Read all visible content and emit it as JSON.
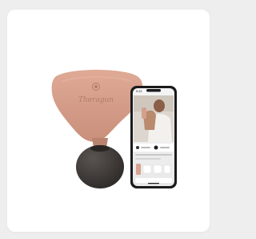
{
  "product": {
    "device_logo_text": "Theragun",
    "phone_time": "9:41",
    "colors": {
      "device_body": "#d8a28e",
      "device_body_shade": "#c48b77",
      "attachment": "#3f3a38",
      "phone_frame": "#1b1b1d",
      "card_bg": "#ffffff",
      "page_bg": "#eeeeee"
    }
  }
}
